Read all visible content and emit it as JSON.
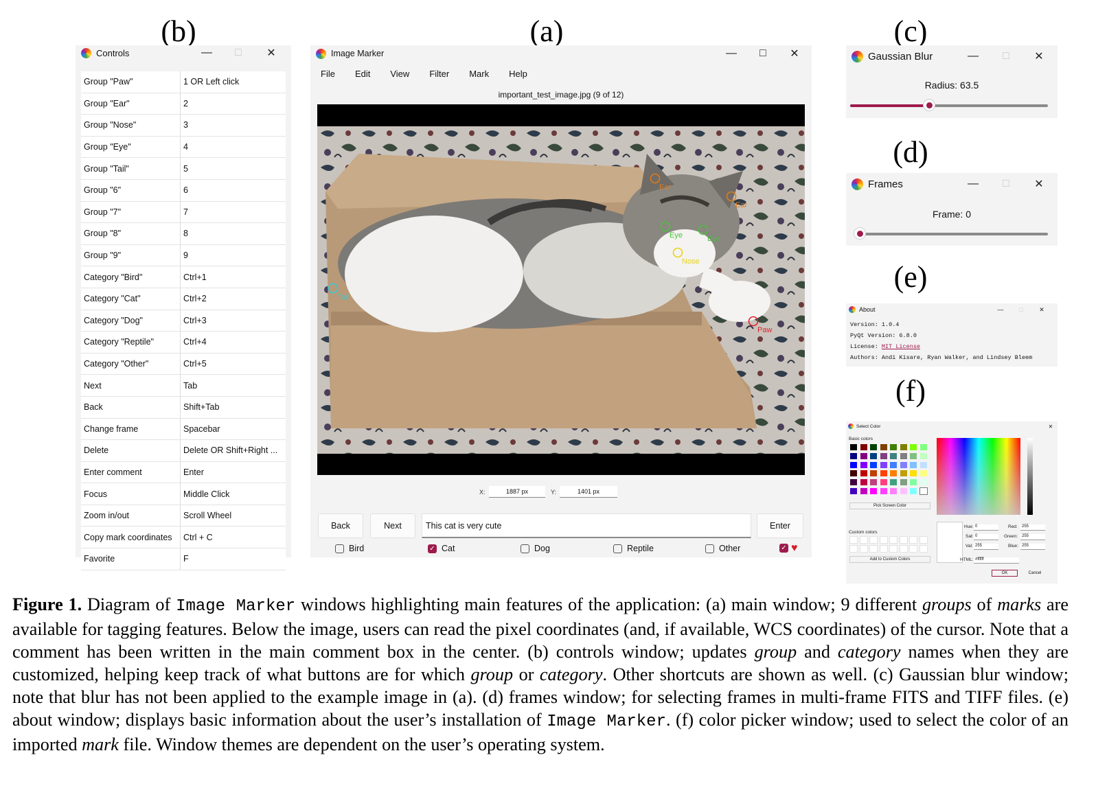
{
  "panel_labels": {
    "a": "(a)",
    "b": "(b)",
    "c": "(c)",
    "d": "(d)",
    "e": "(e)",
    "f": "(f)"
  },
  "controls": {
    "title": "Controls",
    "rows": [
      {
        "key": "Group \"Paw\"",
        "value": "1 OR Left click"
      },
      {
        "key": "Group \"Ear\"",
        "value": "2"
      },
      {
        "key": "Group \"Nose\"",
        "value": "3"
      },
      {
        "key": "Group \"Eye\"",
        "value": "4"
      },
      {
        "key": "Group \"Tail\"",
        "value": "5"
      },
      {
        "key": "Group \"6\"",
        "value": "6"
      },
      {
        "key": "Group \"7\"",
        "value": "7"
      },
      {
        "key": "Group \"8\"",
        "value": "8"
      },
      {
        "key": "Group \"9\"",
        "value": "9"
      },
      {
        "key": "Category \"Bird\"",
        "value": "Ctrl+1"
      },
      {
        "key": "Category \"Cat\"",
        "value": "Ctrl+2"
      },
      {
        "key": "Category \"Dog\"",
        "value": "Ctrl+3"
      },
      {
        "key": "Category \"Reptile\"",
        "value": "Ctrl+4"
      },
      {
        "key": "Category \"Other\"",
        "value": "Ctrl+5"
      },
      {
        "key": "Next",
        "value": "Tab"
      },
      {
        "key": "Back",
        "value": "Shift+Tab"
      },
      {
        "key": "Change frame",
        "value": "Spacebar"
      },
      {
        "key": "Delete",
        "value": "Delete OR Shift+Right ..."
      },
      {
        "key": "Enter comment",
        "value": "Enter"
      },
      {
        "key": "Focus",
        "value": "Middle Click"
      },
      {
        "key": "Zoom in/out",
        "value": "Scroll Wheel"
      },
      {
        "key": "Copy mark coordinates",
        "value": "Ctrl + C"
      },
      {
        "key": "Favorite",
        "value": "F"
      }
    ]
  },
  "main": {
    "title": "Image Marker",
    "menu": [
      "File",
      "Edit",
      "View",
      "Filter",
      "Mark",
      "Help"
    ],
    "filename": "important_test_image.jpg (9 of 12)",
    "marks": [
      {
        "label": "Ear",
        "color": "#e07b1a"
      },
      {
        "label": "Ear",
        "color": "#e07b1a"
      },
      {
        "label": "Eye",
        "color": "#48c23a"
      },
      {
        "label": "Eye",
        "color": "#48c23a"
      },
      {
        "label": "Nose",
        "color": "#e8d21e"
      },
      {
        "label": "Tail",
        "color": "#36c9d6"
      },
      {
        "label": "Paw",
        "color": "#e0242c"
      }
    ],
    "x_label": "X:",
    "x_value": "1887 px",
    "y_label": "Y:",
    "y_value": "1401 px",
    "back_label": "Back",
    "next_label": "Next",
    "comment": "This cat is very cute",
    "enter_label": "Enter",
    "categories": [
      {
        "label": "Bird",
        "checked": false
      },
      {
        "label": "Cat",
        "checked": true
      },
      {
        "label": "Dog",
        "checked": false
      },
      {
        "label": "Reptile",
        "checked": false
      },
      {
        "label": "Other",
        "checked": false
      }
    ],
    "favorite": true
  },
  "blur": {
    "title": "Gaussian Blur",
    "label": "Radius: 63.5",
    "level": 0.4
  },
  "frames": {
    "title": "Frames",
    "label": "Frame: 0",
    "level": 0.0
  },
  "about": {
    "title": "About",
    "version": "Version: 1.0.4",
    "pyqt": "PyQt Version: 6.8.0",
    "license_prefix": "License: ",
    "license_link": "MIT License",
    "authors": "Authors: Andi Kisare, Ryan Walker, and Lindsey Bleem"
  },
  "color_picker": {
    "title": "Select Color",
    "basic_colors_label": "Basic colors",
    "pick_screen_label": "Pick Screen Color",
    "custom_colors_label": "Custom colors",
    "add_custom_label": "Add to Custom Colors",
    "hue_label": "Hue:",
    "hue": "0",
    "sat_label": "Sat:",
    "sat": "0",
    "val_label": "Val:",
    "val": "255",
    "red_label": "Red:",
    "red": "255",
    "green_label": "Green:",
    "green": "255",
    "blue_label": "Blue:",
    "blue": "255",
    "html_label": "HTML:",
    "html": "#ffffff",
    "ok_label": "OK",
    "cancel_label": "Cancel",
    "basic_colors": [
      "#000000",
      "#800000",
      "#004000",
      "#804000",
      "#408000",
      "#808000",
      "#80ff00",
      "#80ff80",
      "#000080",
      "#800080",
      "#004080",
      "#804080",
      "#408080",
      "#808080",
      "#80c080",
      "#c0ffc0",
      "#0000ff",
      "#8000ff",
      "#0040ff",
      "#8040ff",
      "#4080ff",
      "#8080ff",
      "#80c0ff",
      "#c0e0ff",
      "#400000",
      "#c00000",
      "#c04000",
      "#ff4000",
      "#ff8000",
      "#c0a000",
      "#ffe000",
      "#ffff80",
      "#400040",
      "#c00040",
      "#c04080",
      "#ff4080",
      "#40a080",
      "#80a080",
      "#80ffa0",
      "#e0fff0",
      "#4000c0",
      "#c000c0",
      "#ff00ff",
      "#ff40ff",
      "#ff80ff",
      "#ffc0ff",
      "#80ffff",
      "#ffffff"
    ]
  },
  "caption": {
    "fig": "Figure 1.",
    "t1": " Diagram of ",
    "code1": "Image Marker",
    "t2": " windows highlighting main features of the application: (a) main window; 9 different ",
    "i1": "groups",
    "t3": " of ",
    "i2": "marks",
    "t4": " are available for tagging features. Below the image, users can read the pixel coordinates (and, if available, WCS coordinates) of the cursor. Note that a comment has been written in the main comment box in the center. (b) controls window; updates ",
    "i3": "group",
    "t5": " and ",
    "i4": "category",
    "t6": " names when they are customized, helping keep track of what buttons are for which ",
    "i5": "group",
    "t7": " or ",
    "i6": "category",
    "t8": ". Other shortcuts are shown as well. (c) Gaussian blur window; note that blur has not been applied to the example image in (a). (d) frames window; for selecting frames in multi-frame FITS and TIFF files. (e) about window; displays basic information about the user’s installation of ",
    "code2": "Image Marker",
    "t9": ". (f) color picker window; used to select the color of an imported ",
    "i7": "mark",
    "t10": " file. Window themes are dependent on the user’s operating system."
  }
}
